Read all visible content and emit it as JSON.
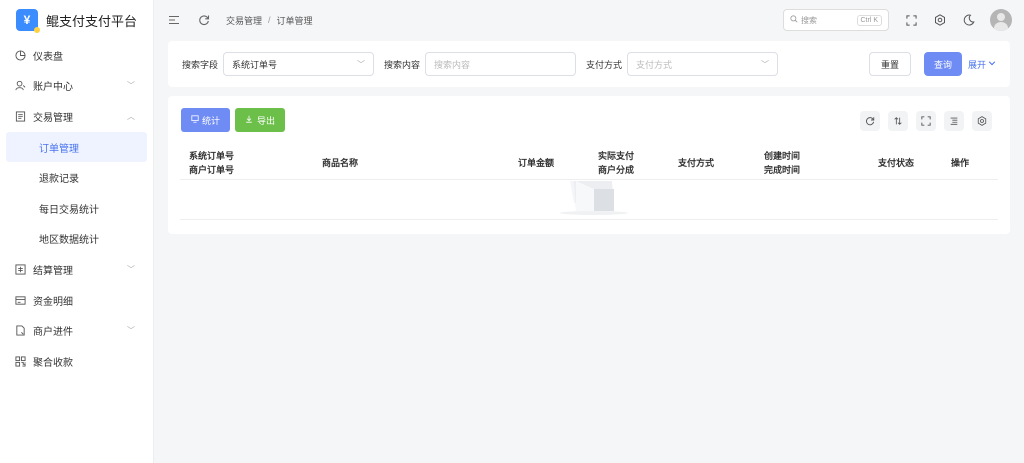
{
  "app": {
    "title": "鲲支付支付平台",
    "logo_glyph": "¥"
  },
  "sidebar": {
    "items": [
      {
        "label": "仪表盘",
        "icon": "dashboard-icon"
      },
      {
        "label": "账户中心",
        "icon": "user-icon",
        "has_children": true
      },
      {
        "label": "交易管理",
        "icon": "document-icon",
        "has_children": true,
        "expanded": true,
        "children": [
          {
            "label": "订单管理",
            "active": true
          },
          {
            "label": "退款记录"
          },
          {
            "label": "每日交易统计"
          },
          {
            "label": "地区数据统计"
          }
        ]
      },
      {
        "label": "结算管理",
        "icon": "settlement-icon",
        "has_children": true
      },
      {
        "label": "资金明细",
        "icon": "card-icon"
      },
      {
        "label": "商户进件",
        "icon": "file-icon",
        "has_children": true
      },
      {
        "label": "聚合收款",
        "icon": "qrcode-icon"
      }
    ]
  },
  "header": {
    "breadcrumb": [
      "交易管理",
      "订单管理"
    ],
    "search_placeholder": "搜索",
    "search_shortcut": "Ctrl K"
  },
  "filter": {
    "field_label": "搜索字段",
    "field_value": "系统订单号",
    "content_label": "搜索内容",
    "content_placeholder": "搜索内容",
    "payment_label": "支付方式",
    "payment_placeholder": "支付方式",
    "reset_label": "重置",
    "query_label": "查询",
    "expand_label": "展开"
  },
  "table": {
    "stat_button": "统计",
    "export_button": "导出",
    "columns": [
      {
        "line1": "系统订单号",
        "line2": "商户订单号"
      },
      {
        "line1": "商品名称",
        "line2": ""
      },
      {
        "line1": "订单金额",
        "line2": ""
      },
      {
        "line1": "实际支付",
        "line2": "商户分成"
      },
      {
        "line1": "支付方式",
        "line2": ""
      },
      {
        "line1": "创建时间",
        "line2": "完成时间"
      },
      {
        "line1": "支付状态",
        "line2": ""
      },
      {
        "line1": "操作",
        "line2": ""
      }
    ],
    "rows": []
  },
  "colors": {
    "primary": "#6f8cf5",
    "success": "#6cc04a",
    "active_text": "#4a73f0",
    "active_bg": "#eef3ff"
  }
}
